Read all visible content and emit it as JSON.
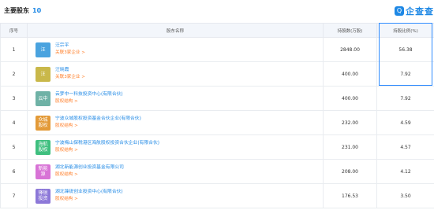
{
  "header": {
    "title": "主要股东",
    "count": "10",
    "brand_text": "企查查",
    "brand_icon_glyph": "Q"
  },
  "table": {
    "columns": [
      "序号",
      "股东名称",
      "持股数(万股)",
      "持股比例(%)"
    ],
    "rows": [
      {
        "index": "1",
        "avatar": "汪",
        "avatar_color": "#4aa3df",
        "name": "汪宗平",
        "sub": "关联3家企业 >",
        "shares": "2848.00",
        "ratio": "56.38"
      },
      {
        "index": "2",
        "avatar": "汪",
        "avatar_color": "#c9b84a",
        "name": "汪晓霞",
        "sub": "关联3家企业 >",
        "shares": "400.00",
        "ratio": "7.92"
      },
      {
        "index": "3",
        "avatar": "云中",
        "avatar_color": "#6fb2a6",
        "name": "云梦中一科技投资中心(有限合伙)",
        "sub": "股权结构 >",
        "shares": "400.00",
        "ratio": "7.92"
      },
      {
        "index": "4",
        "avatar": "众城\n股权",
        "avatar_color": "#e39a38",
        "name": "宁波众城股权投资基金合伙企业(有限合伙)",
        "sub": "股权结构 >",
        "shares": "232.00",
        "ratio": "4.59"
      },
      {
        "index": "5",
        "avatar": "海航\n股权",
        "avatar_color": "#3fbf7f",
        "name": "宁波梅山保税港区海航股权投资合伙企业(有限合伙)",
        "sub": "股权结构 >",
        "shares": "231.00",
        "ratio": "4.57"
      },
      {
        "index": "6",
        "avatar": "新能\n源",
        "avatar_color": "#d873d6",
        "name": "湖北新能源创业投资基金有限公司",
        "sub": "股权结构 >",
        "shares": "208.00",
        "ratio": "4.12"
      },
      {
        "index": "7",
        "avatar": "锋锐\n投资",
        "avatar_color": "#8c78d8",
        "name": "湖北锋锐创业投资中心(有限合伙)",
        "sub": "股权结构 >",
        "shares": "176.53",
        "ratio": "3.50"
      }
    ]
  }
}
